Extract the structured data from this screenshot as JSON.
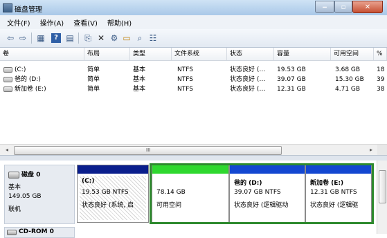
{
  "window": {
    "title": "磁盘管理",
    "min": "‒",
    "max": "▫",
    "close": "✕"
  },
  "menu": [
    "文件(F)",
    "操作(A)",
    "查看(V)",
    "帮助(H)"
  ],
  "toolbar": {
    "icons": [
      "back-arrow-icon",
      "forward-arrow-icon",
      "grid-icon",
      "help-icon",
      "grid-icon-2",
      "refresh-icon",
      "delete-x-icon",
      "connect-icon",
      "folder-open-icon",
      "magnify-icon",
      "properties-icon"
    ]
  },
  "table": {
    "columns": [
      "卷",
      "布局",
      "类型",
      "文件系统",
      "状态",
      "容量",
      "可用空间",
      "%"
    ],
    "rows": [
      [
        "(C:)",
        "简单",
        "基本",
        "NTFS",
        "状态良好 (…",
        "19.53 GB",
        "3.68 GB",
        "18"
      ],
      [
        "爸的 (D:)",
        "简单",
        "基本",
        "NTFS",
        "状态良好 (…",
        "39.07 GB",
        "15.30 GB",
        "39"
      ],
      [
        "新加卷 (E:)",
        "简单",
        "基本",
        "NTFS",
        "状态良好 (…",
        "12.31 GB",
        "4.71 GB",
        "38"
      ]
    ]
  },
  "scroll": {
    "grip": "III",
    "left": "◂",
    "right": "▸"
  },
  "disk0": {
    "name": "磁盘 0",
    "type": "基本",
    "size": "149.05 GB",
    "status": "联机"
  },
  "partitions": [
    {
      "name": "(C:)",
      "line1": "19.53 GB NTFS",
      "line2": "状态良好 (系统, 启",
      "color": "#0a1e8c"
    },
    {
      "name": "",
      "line1": "78.14 GB",
      "line2": "可用空间",
      "color": "#2fd82f"
    },
    {
      "name": "爸的 (D:)",
      "line1": "39.07 GB NTFS",
      "line2": "状态良好 (逻辑驱动",
      "color": "#1347d1"
    },
    {
      "name": "新加卷 (E:)",
      "line1": "12.31 GB NTFS",
      "line2": "状态良好 (逻辑驱",
      "color": "#1347d1"
    }
  ],
  "cdrom": {
    "name": "CD-ROM 0"
  }
}
